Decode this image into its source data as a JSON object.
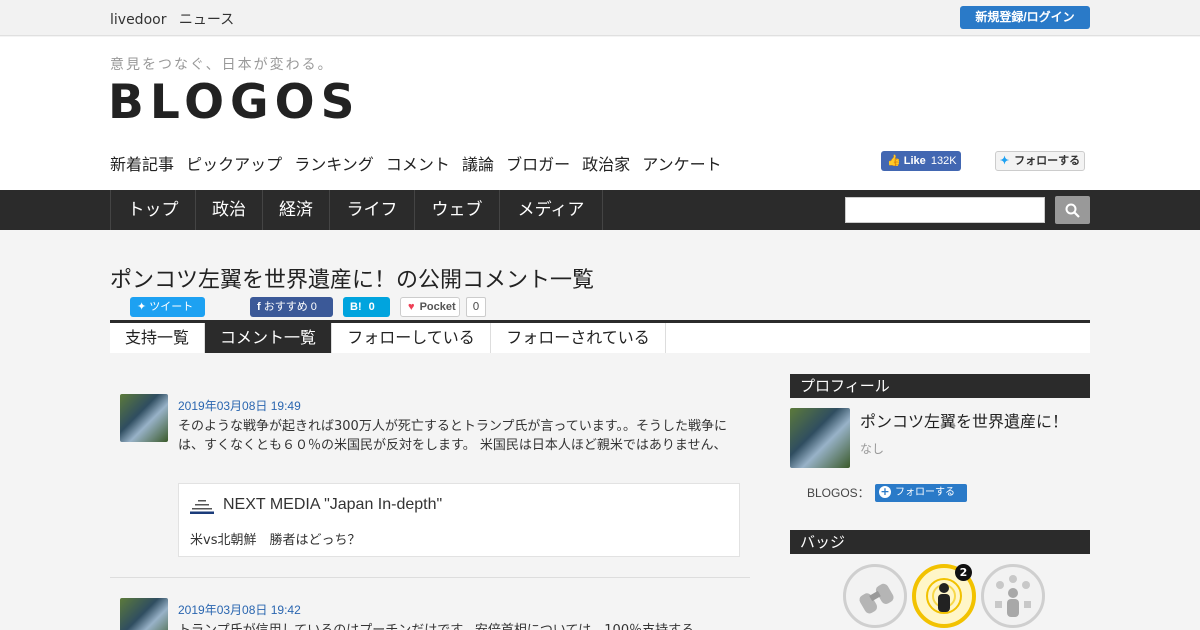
{
  "topbar": {
    "brand_livedoor": "livedoor",
    "brand_news": "ニュース",
    "login_label": "新規登録/ログイン"
  },
  "header": {
    "tagline": "意見をつなぐ、日本が変わる。",
    "logo": "BLOGOS",
    "subnav": [
      "新着記事",
      "ピックアップ",
      "ランキング",
      "コメント",
      "議論",
      "ブロガー",
      "政治家",
      "アンケート"
    ],
    "fb_like_label": "Like",
    "fb_like_count": "132K",
    "tw_follow_label": "フォローする"
  },
  "mainnav": {
    "items": [
      "トップ",
      "政治",
      "経済",
      "ライフ",
      "ウェブ",
      "メディア"
    ],
    "search_placeholder": ""
  },
  "page": {
    "title": "ポンコツ左翼を世界遺産に！の公開コメント一覧",
    "share": {
      "tweet": "ツイート",
      "fb_recommend": "おすすめ",
      "fb_count": "0",
      "hatena_label": "B!",
      "hatena_count": "0",
      "pocket_label": "Pocket",
      "pocket_count": "0"
    },
    "tabs": [
      "支持一覧",
      "コメント一覧",
      "フォローしている",
      "フォローされている"
    ],
    "active_tab": "コメント一覧"
  },
  "comments": [
    {
      "date": "2019年03月08日 19:49",
      "body": "そのような戦争が起きれば300万人が死亡するとトランプ氏が言っています。。そうした戦争には、すくなくとも６０％の米国民が反対をします。 米国民は日本人ほど親米ではありません、",
      "source_name": "NEXT MEDIA \"Japan In-depth\"",
      "article_title": "米vs北朝鮮　勝者はどっち？"
    },
    {
      "date": "2019年03月08日 19:42",
      "body": "トランプ氏が信用しているのはプーチンだけです。安倍首相については、100％支持する"
    }
  ],
  "sidebar": {
    "profile_heading": "プロフィール",
    "profile_name": "ポンコツ左翼を世界遺産に！",
    "profile_sub": "なし",
    "blogos_label": "BLOGOS：",
    "follow_label": "フォローする",
    "badge_heading": "バッジ",
    "badge_count": "2"
  },
  "colors": {
    "accent_blue": "#2a7ac8",
    "nav_dark": "#2b2b2b",
    "badge_gold": "#f2c200"
  }
}
